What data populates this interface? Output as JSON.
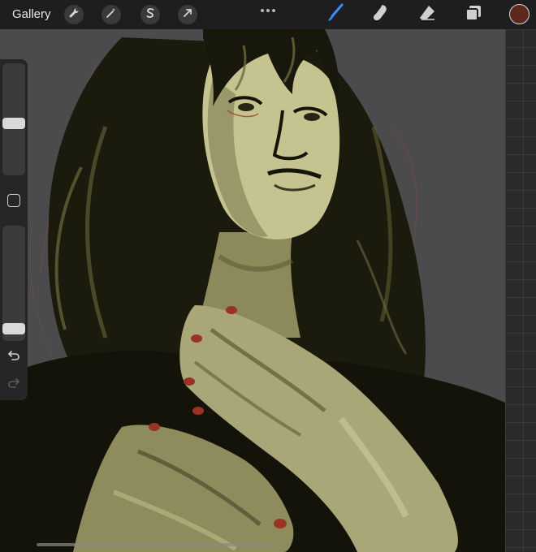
{
  "toolbar": {
    "gallery_label": "Gallery",
    "actions_icon": "wrench-icon",
    "adjustments_icon": "magic-wand-icon",
    "selection_icon": "selection-s-icon",
    "transform_icon": "cursor-arrow-icon",
    "more_icon": "ellipsis-icon",
    "brush_icon": "brush-icon",
    "smudge_icon": "smudge-icon",
    "eraser_icon": "eraser-icon",
    "layers_icon": "layers-icon",
    "current_color": "#5a2a1c"
  },
  "sidebar": {
    "brush_size": 0.46,
    "opacity": 0.06,
    "modify_icon": "square-icon",
    "undo_icon": "undo-icon",
    "redo_icon": "redo-icon"
  },
  "colors": {
    "background": "#4b4b4e",
    "skin_light": "#c9c79a",
    "skin_mid": "#8f8c5f",
    "hair_dark": "#131308",
    "nails": "#9a3324"
  }
}
